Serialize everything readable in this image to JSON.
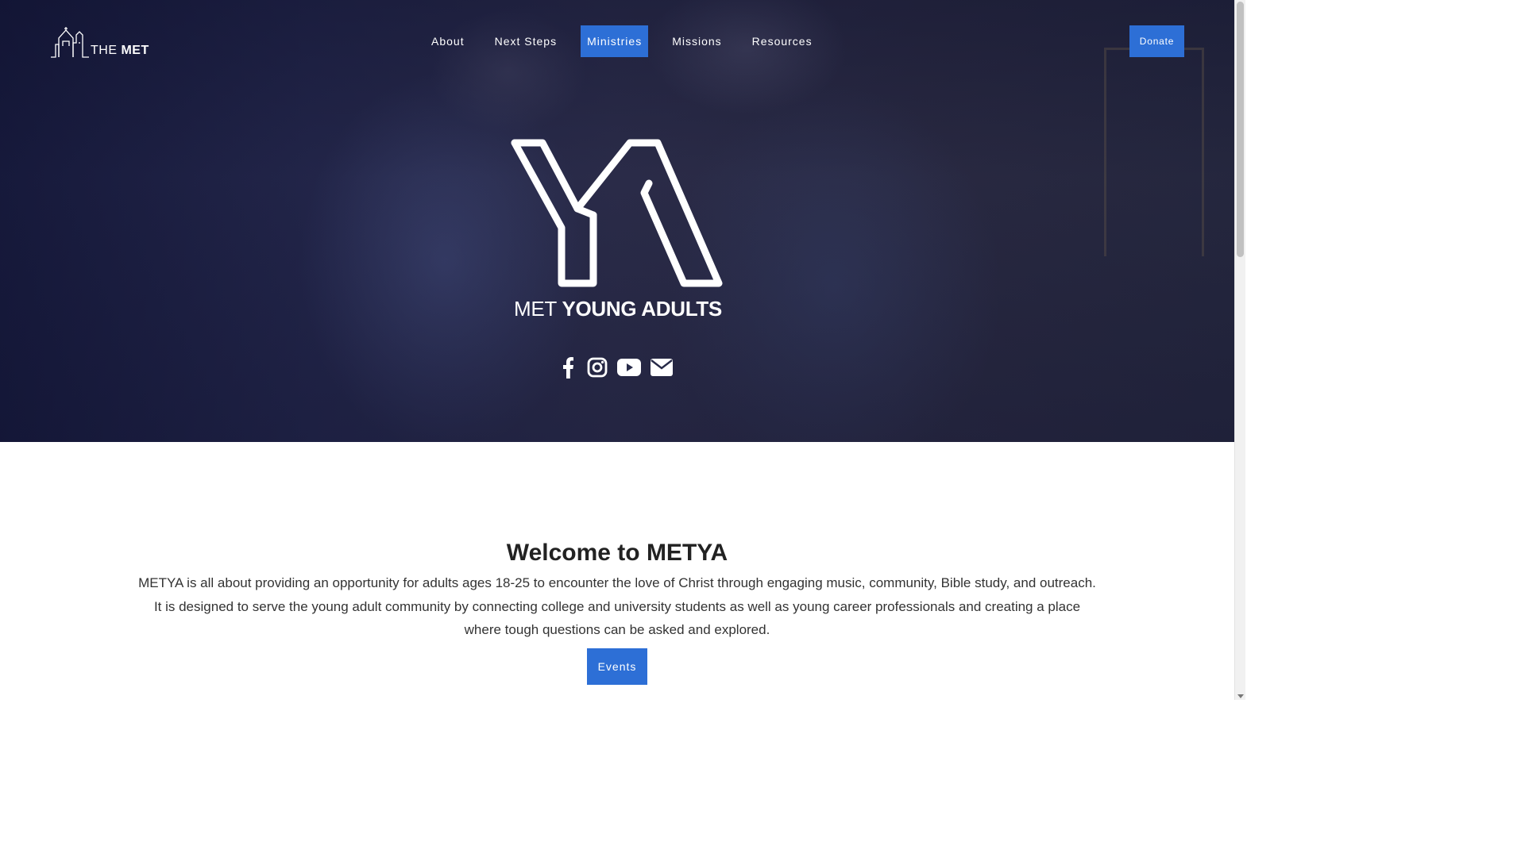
{
  "site": {
    "logo_text_light": "THE",
    "logo_text_bold": "MET"
  },
  "nav": {
    "items": [
      {
        "label": "About"
      },
      {
        "label": "Next Steps"
      },
      {
        "label": "Ministries",
        "active": true
      },
      {
        "label": "Missions"
      },
      {
        "label": "Resources"
      }
    ],
    "donate_label": "Donate"
  },
  "hero": {
    "caption_light": "MET",
    "caption_bold": "YOUNG ADULTS",
    "social_icons": [
      "facebook-icon",
      "instagram-icon",
      "youtube-icon",
      "envelope-icon"
    ]
  },
  "content": {
    "title": "Welcome to METYA",
    "body": "METYA is all about providing an opportunity for adults ages 18-25 to encounter the love of Christ through engaging music, community, Bible study, and outreach. It is designed to serve the young adult community by connecting college and university students as well as young career professionals and creating a place where tough questions can be asked and explored.",
    "events_label": "Events"
  },
  "colors": {
    "accent": "#2d6fd6",
    "hero_overlay": "#1e2148",
    "heading_text": "#222222"
  }
}
